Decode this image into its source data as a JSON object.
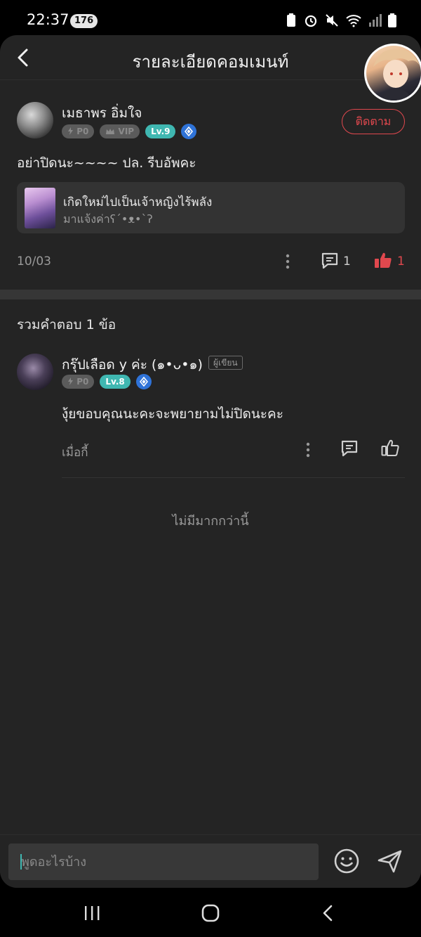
{
  "status_bar": {
    "time": "22:37",
    "notification_count": "176"
  },
  "header": {
    "title": "รายละเอียดคอมเมนท์"
  },
  "comment": {
    "author": "เมธาพร อิ่มใจ",
    "badge_p": "P0",
    "badge_vip": "VIP",
    "level": "Lv.9",
    "follow_label": "ติดตาม",
    "text": "อย่าปิดนะ~~~~ ปล. รีบอัพคะ",
    "novel": {
      "title": "เกิดใหม่ไปเป็นเจ้าหญิงไร้พลัง",
      "subtitle": "มาแจ้งค่าʕ´•ᴥ•`ʔ"
    },
    "date": "10/03",
    "reply_count": "1",
    "like_count": "1"
  },
  "replies": {
    "title": "รวมคำตอบ 1 ข้อ",
    "items": [
      {
        "author": "กรุ๊ปเลือด y ค่ะ (๑•ᴗ•๑)",
        "writer_tag": "ผู้เขียน",
        "badge_p": "P0",
        "level": "Lv.8",
        "text": "งุ้ยขอบคุณนะคะจะพยายามไม่ปิดนะคะ",
        "time": "เมื่อกี้"
      }
    ],
    "no_more": "ไม่มีมากกว่านี้"
  },
  "input": {
    "placeholder": "พูดอะไรบ้าง"
  },
  "colors": {
    "accent_red": "#e0484e",
    "level_teal": "#3fb7b1",
    "diamond_blue": "#2f73d8"
  },
  "icons": [
    "back-icon",
    "more-icon",
    "comment-icon",
    "thumbs-up-icon",
    "emoji-icon",
    "send-icon",
    "diamond-icon",
    "bolt-icon",
    "crown-icon"
  ]
}
